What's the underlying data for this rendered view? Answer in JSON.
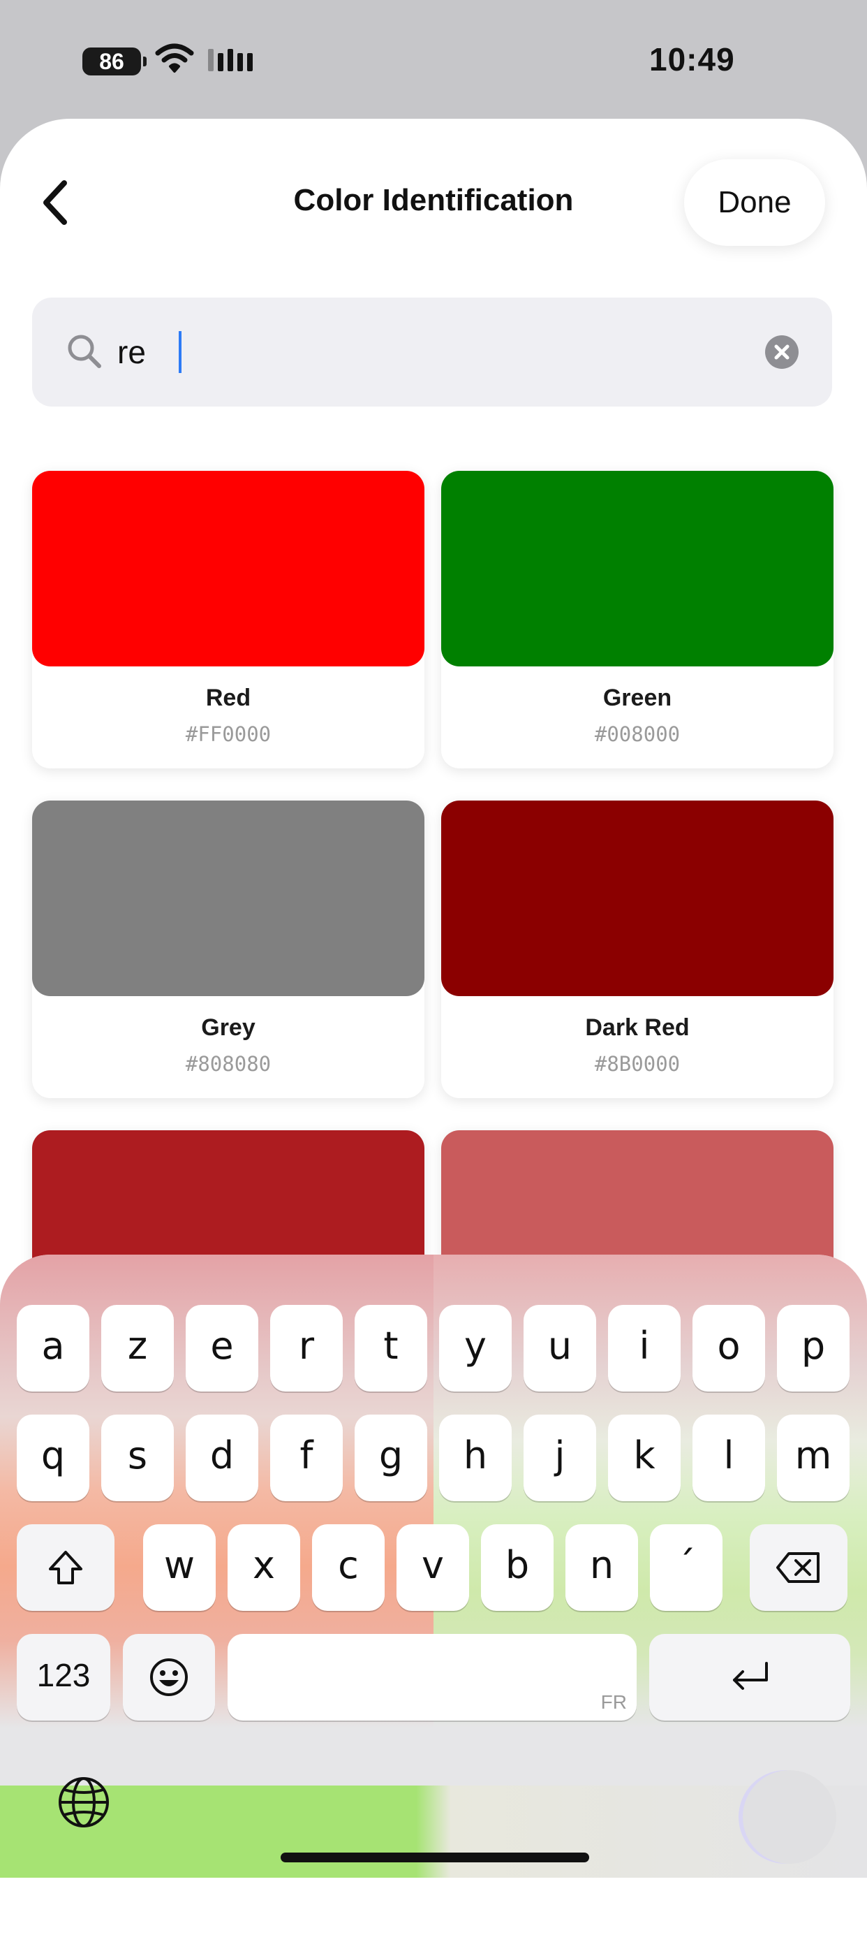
{
  "status_bar": {
    "battery": "86",
    "time": "10:49"
  },
  "nav": {
    "title": "Color Identification",
    "done_label": "Done"
  },
  "search": {
    "query": "re"
  },
  "colors": [
    {
      "name": "Red",
      "hex": "#FF0000",
      "swatch": "#ff0000"
    },
    {
      "name": "Green",
      "hex": "#008000",
      "swatch": "#008000"
    },
    {
      "name": "Grey",
      "hex": "#808080",
      "swatch": "#808080"
    },
    {
      "name": "Dark Red",
      "hex": "#8B0000",
      "swatch": "#8b0000"
    },
    {
      "name": "",
      "hex": "",
      "swatch": "#ad1c20"
    },
    {
      "name": "",
      "hex": "",
      "swatch": "#c95b5c"
    }
  ],
  "keyboard": {
    "row1": [
      "a",
      "z",
      "e",
      "r",
      "t",
      "y",
      "u",
      "i",
      "o",
      "p"
    ],
    "row2": [
      "q",
      "s",
      "d",
      "f",
      "g",
      "h",
      "j",
      "k",
      "l",
      "m"
    ],
    "row3": [
      "w",
      "x",
      "c",
      "v",
      "b",
      "n",
      "´"
    ],
    "numbers_label": "123",
    "space_language": "FR",
    "icons": [
      "shift-icon",
      "delete-icon",
      "emoji-icon",
      "return-icon",
      "globe-icon",
      "dictation-icon"
    ]
  }
}
